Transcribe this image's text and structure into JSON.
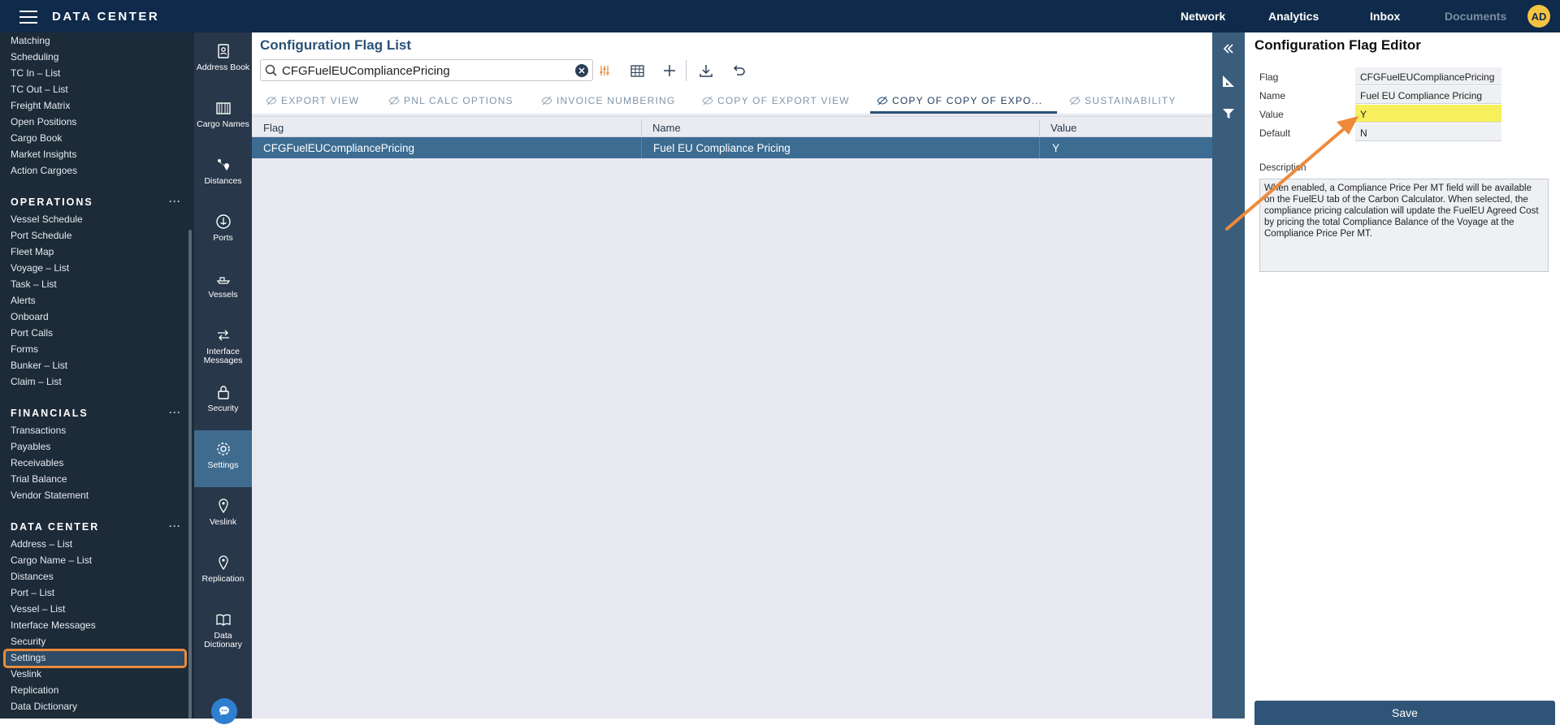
{
  "app": {
    "title": "DATA CENTER",
    "avatar": "AD"
  },
  "topnav": [
    {
      "label": "Network"
    },
    {
      "label": "Analytics"
    },
    {
      "label": "Inbox"
    },
    {
      "label": "Documents",
      "disabled": true
    }
  ],
  "leftnav": {
    "top_items": [
      "Matching",
      "Scheduling",
      "TC In – List",
      "TC Out – List",
      "Freight Matrix",
      "Open Positions",
      "Cargo Book",
      "Market Insights",
      "Action Cargoes"
    ],
    "operations": {
      "header": "OPERATIONS",
      "more": "···",
      "items": [
        "Vessel Schedule",
        "Port Schedule",
        "Fleet Map",
        "Voyage – List",
        "Task – List",
        "Alerts",
        "Onboard",
        "Port Calls",
        "Forms",
        "Bunker – List",
        "Claim – List"
      ]
    },
    "financials": {
      "header": "FINANCIALS",
      "more": "···",
      "items": [
        "Transactions",
        "Payables",
        "Receivables",
        "Trial Balance",
        "Vendor Statement"
      ]
    },
    "datacenter": {
      "header": "DATA CENTER",
      "more": "···",
      "items": [
        "Address – List",
        "Cargo Name – List",
        "Distances",
        "Port – List",
        "Vessel – List",
        "Interface Messages",
        "Security",
        "Settings",
        "Veslink",
        "Replication",
        "Data Dictionary"
      ]
    }
  },
  "rail": [
    {
      "label": "Address Book",
      "icon": "address-book-icon"
    },
    {
      "label": "Cargo Names",
      "icon": "cargo-icon"
    },
    {
      "label": "Distances",
      "icon": "distances-icon"
    },
    {
      "label": "Ports",
      "icon": "anchor-icon"
    },
    {
      "label": "Vessels",
      "icon": "vessel-icon"
    },
    {
      "label": "Interface Messages",
      "icon": "exchange-icon"
    },
    {
      "label": "Security",
      "icon": "lock-icon"
    },
    {
      "label": "Settings",
      "icon": "gear-icon",
      "active": true
    },
    {
      "label": "Veslink",
      "icon": "map-pin-icon"
    },
    {
      "label": "Replication",
      "icon": "map-pin-icon"
    },
    {
      "label": "Data Dictionary",
      "icon": "book-icon"
    }
  ],
  "main": {
    "title": "Configuration Flag List",
    "search": {
      "value": "CFGFuelEUCompliancePricing"
    },
    "tabs": [
      {
        "label": "EXPORT VIEW"
      },
      {
        "label": "PNL CALC OPTIONS"
      },
      {
        "label": "INVOICE NUMBERING"
      },
      {
        "label": "COPY OF EXPORT VIEW"
      },
      {
        "label": "COPY OF COPY OF EXPO...",
        "active": true
      },
      {
        "label": "SUSTAINABILITY"
      }
    ],
    "table": {
      "columns": [
        "Flag",
        "Name",
        "Value"
      ],
      "rows": [
        [
          "CFGFuelEUCompliancePricing",
          "Fuel EU Compliance Pricing",
          "Y"
        ]
      ]
    }
  },
  "editor": {
    "title": "Configuration Flag Editor",
    "fields": [
      {
        "label": "Flag",
        "value": "CFGFuelEUCompliancePricing"
      },
      {
        "label": "Name",
        "value": "Fuel EU Compliance Pricing"
      },
      {
        "label": "Value",
        "value": "Y",
        "highlight": true
      },
      {
        "label": "Default",
        "value": "N"
      }
    ],
    "description_label": "Description",
    "description": "When enabled, a Compliance Price Per MT field will be available on the FuelEU tab of the Carbon Calculator. When selected, the compliance pricing calculation will update the FuelEU Agreed Cost by pricing the total Compliance Balance of the Voyage at the Compliance Price Per MT.",
    "save_label": "Save"
  },
  "colors": {
    "topbar": "#0f2a4a",
    "accent": "#e98a3c",
    "highlight": "#f7ef5c",
    "row_selected": "#3c6c92"
  }
}
